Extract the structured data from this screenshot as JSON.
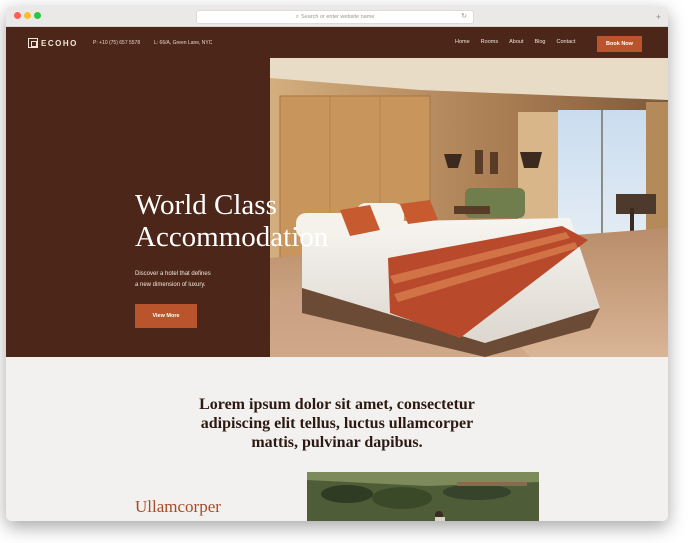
{
  "browser": {
    "url_placeholder": "Search or enter website name",
    "search_icon": "magnifier-icon",
    "reload_icon": "reload-icon",
    "new_tab_icon": "plus-icon"
  },
  "nav": {
    "logo_text": "ECOHO",
    "phone": "P: +10 (75) 657 5578",
    "address": "L: 66/A, Green Lane, NYC",
    "links": [
      "Home",
      "Rooms",
      "About",
      "Blog",
      "Contact"
    ],
    "cta": "Book Now"
  },
  "hero": {
    "title_line1": "World Class",
    "title_line2": "Accommodation",
    "subtitle_line1": "Discover a hotel that defines",
    "subtitle_line2": "a new dimension of luxury.",
    "button": "View More"
  },
  "intro": {
    "line1": "Lorem ipsum dolor sit amet, consectetur",
    "line2": "adipiscing elit tellus, luctus ullamcorper",
    "line3": "mattis, pulvinar dapibus."
  },
  "feature": {
    "heading": "Ullamcorper"
  },
  "colors": {
    "brand_dark": "#4c2618",
    "accent": "#b9542c",
    "heading_accent": "#a74a25"
  }
}
